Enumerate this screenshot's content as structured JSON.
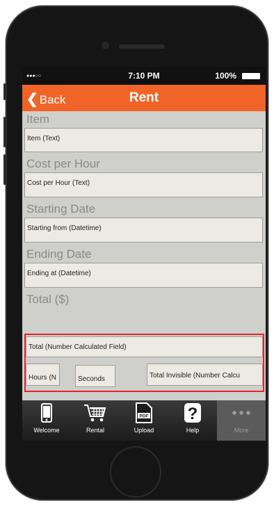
{
  "status_bar": {
    "signal": "●●●○○",
    "time": "7:10 PM",
    "battery": "100%"
  },
  "nav": {
    "back_label": "Back",
    "title": "Rent"
  },
  "form": {
    "item": {
      "label": "Item",
      "value": "Item (Text)"
    },
    "cost": {
      "label": "Cost per Hour",
      "value": "Cost per Hour (Text)"
    },
    "start": {
      "label": "Starting Date",
      "value": "Starting from (Datetime)"
    },
    "end": {
      "label": "Ending Date",
      "value": "Ending at (Datetime)"
    },
    "total": {
      "label": "Total ($)",
      "value": "Total (Number Calculated Field)"
    },
    "hours": "Hours (N",
    "seconds": "Seconds",
    "total_invisible": "Total Invisible (Number Calcu"
  },
  "tabs": [
    {
      "label": "Welcome",
      "icon": "phone-icon"
    },
    {
      "label": "Rental",
      "icon": "cart-icon"
    },
    {
      "label": "Upload",
      "icon": "pdf-icon"
    },
    {
      "label": "Help",
      "icon": "help-icon"
    },
    {
      "label": "More",
      "icon": "more-icon"
    }
  ],
  "pdf_badge": "PDF",
  "colors": {
    "nav_bar": "#f06428",
    "highlight_border": "#e0262b",
    "screen_bg": "#cfcfcc"
  }
}
